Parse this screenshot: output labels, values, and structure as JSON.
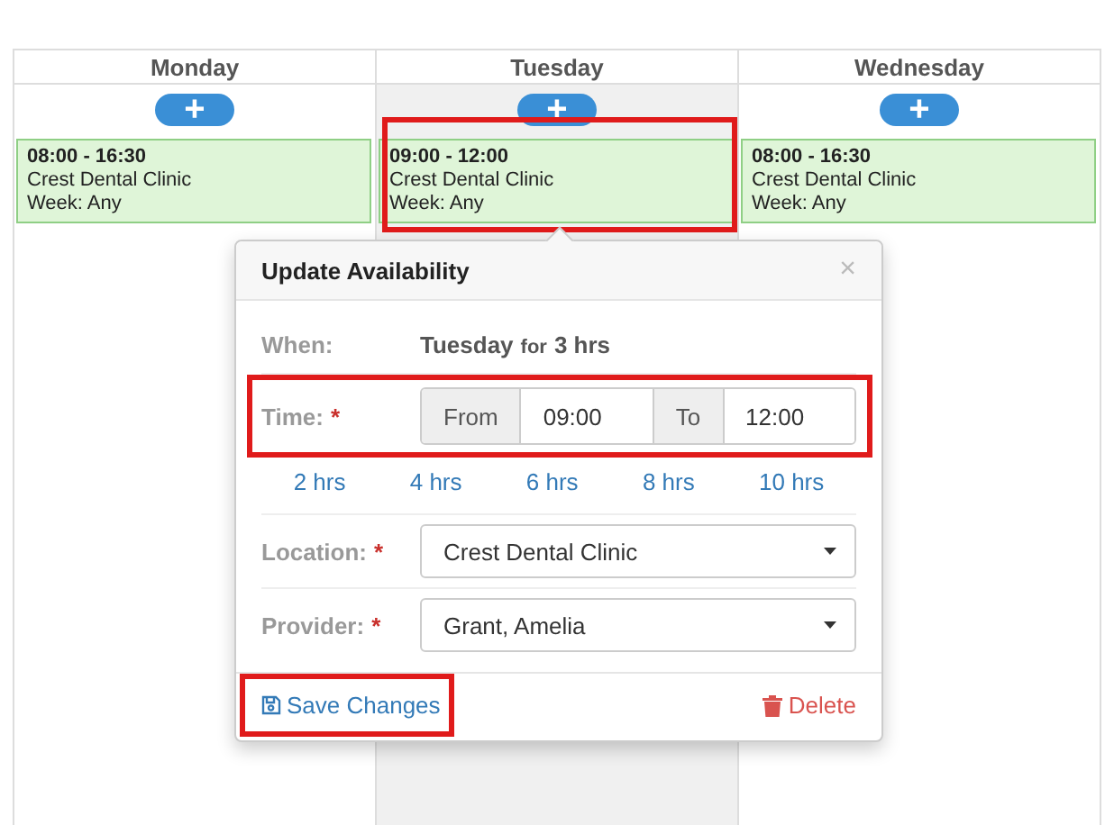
{
  "days": [
    {
      "name": "Monday",
      "selected": false,
      "slot": {
        "time": "08:00 - 16:30",
        "location": "Crest Dental Clinic",
        "week": "Week: Any",
        "highlighted": false
      }
    },
    {
      "name": "Tuesday",
      "selected": true,
      "slot": {
        "time": "09:00 - 12:00",
        "location": "Crest Dental Clinic",
        "week": "Week: Any",
        "highlighted": true
      }
    },
    {
      "name": "Wednesday",
      "selected": false,
      "slot": {
        "time": "08:00 - 16:30",
        "location": "Crest Dental Clinic",
        "week": "Week: Any",
        "highlighted": false
      }
    }
  ],
  "add_button": "+",
  "popover": {
    "title": "Update Availability",
    "close": "×",
    "when": {
      "label": "When:",
      "day": "Tuesday",
      "for": "for",
      "duration": "3 hrs"
    },
    "time": {
      "label": "Time:",
      "required": "*",
      "from_label": "From",
      "from": "09:00",
      "to_label": "To",
      "to": "12:00",
      "highlighted": true
    },
    "durations": [
      "2 hrs",
      "4 hrs",
      "6 hrs",
      "8 hrs",
      "10 hrs"
    ],
    "location": {
      "label": "Location:",
      "required": "*",
      "value": "Crest Dental Clinic"
    },
    "provider": {
      "label": "Provider:",
      "required": "*",
      "value": "Grant, Amelia"
    },
    "save": {
      "label": "Save Changes",
      "highlighted": true
    },
    "delete": {
      "label": "Delete"
    }
  }
}
